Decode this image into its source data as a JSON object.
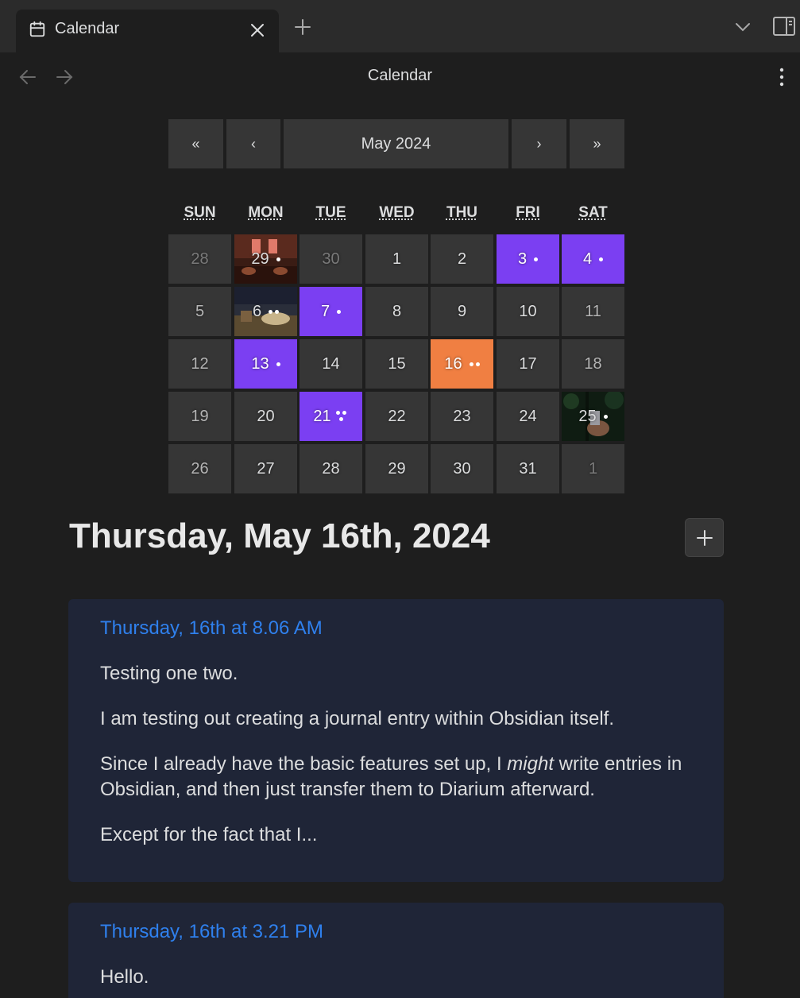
{
  "tab": {
    "title": "Calendar"
  },
  "view": {
    "title": "Calendar"
  },
  "calendar": {
    "nav": {
      "prev_year": "«",
      "prev_month": "‹",
      "month_label": "May 2024",
      "next_month": "›",
      "next_year": "»"
    },
    "weekdays": [
      "SUN",
      "MON",
      "TUE",
      "WED",
      "THU",
      "FRI",
      "SAT"
    ],
    "weeks": [
      [
        {
          "label": "28",
          "state": "other"
        },
        {
          "label": "29",
          "state": "image",
          "dots": 1
        },
        {
          "label": "30",
          "state": "other"
        },
        {
          "label": "1",
          "state": "normal"
        },
        {
          "label": "2",
          "state": "normal"
        },
        {
          "label": "3",
          "state": "entry",
          "dots": 1
        },
        {
          "label": "4",
          "state": "entry",
          "dots": 1
        }
      ],
      [
        {
          "label": "5",
          "state": "weekend"
        },
        {
          "label": "6",
          "state": "image",
          "dots": 2
        },
        {
          "label": "7",
          "state": "entry",
          "dots": 1
        },
        {
          "label": "8",
          "state": "normal"
        },
        {
          "label": "9",
          "state": "normal"
        },
        {
          "label": "10",
          "state": "normal"
        },
        {
          "label": "11",
          "state": "weekend"
        }
      ],
      [
        {
          "label": "12",
          "state": "weekend"
        },
        {
          "label": "13",
          "state": "entry",
          "dots": 1
        },
        {
          "label": "14",
          "state": "normal"
        },
        {
          "label": "15",
          "state": "normal"
        },
        {
          "label": "16",
          "state": "selected",
          "dots": 2
        },
        {
          "label": "17",
          "state": "normal"
        },
        {
          "label": "18",
          "state": "weekend"
        }
      ],
      [
        {
          "label": "19",
          "state": "weekend"
        },
        {
          "label": "20",
          "state": "normal"
        },
        {
          "label": "21",
          "state": "entry",
          "dots": 3
        },
        {
          "label": "22",
          "state": "normal"
        },
        {
          "label": "23",
          "state": "normal"
        },
        {
          "label": "24",
          "state": "normal"
        },
        {
          "label": "25",
          "state": "image",
          "dots": 1
        }
      ],
      [
        {
          "label": "26",
          "state": "weekend"
        },
        {
          "label": "27",
          "state": "normal"
        },
        {
          "label": "28",
          "state": "normal"
        },
        {
          "label": "29",
          "state": "normal"
        },
        {
          "label": "30",
          "state": "normal"
        },
        {
          "label": "31",
          "state": "normal"
        },
        {
          "label": "1",
          "state": "other"
        }
      ]
    ]
  },
  "day": {
    "heading": "Thursday, May 16th, 2024"
  },
  "entries": [
    {
      "title": "Thursday, 16th at 8.06 AM",
      "p1": "Testing one two.",
      "p2": "I am testing out creating a journal entry within Obsidian itself.",
      "p3_before": "Since I already have the basic features set up, I ",
      "p3_em": "might",
      "p3_after": " write entries in Obsidian, and then just transfer them to Diarium afterward.",
      "p4": "Except for the fact that I..."
    },
    {
      "title": "Thursday, 16th at 3.21 PM",
      "p1": "Hello."
    }
  ],
  "colors": {
    "entry_day": "#7b3ff2",
    "selected_day": "#f07f42",
    "link": "#2f80ed",
    "card_bg": "#1f2537",
    "app_bg": "#1e1e1e"
  },
  "icons": [
    "calendar-icon",
    "close-icon",
    "plus-icon",
    "chevron-down-icon",
    "side-panel-icon",
    "arrow-left-icon",
    "arrow-right-icon",
    "more-options-icon"
  ]
}
